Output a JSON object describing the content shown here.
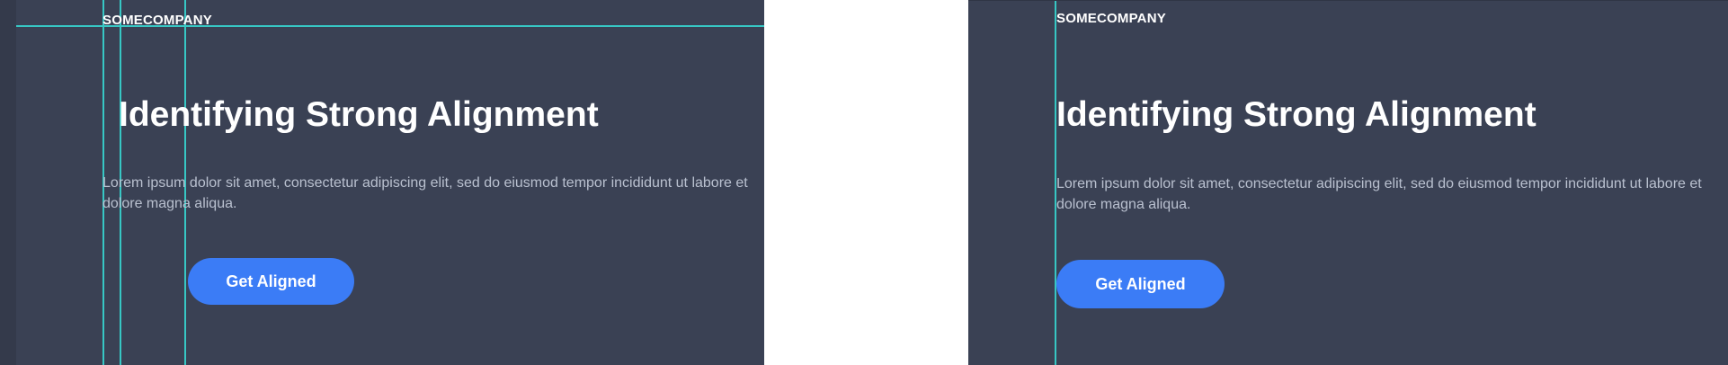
{
  "comparison": {
    "left": {
      "brand": "SOMECOMPANY",
      "headline": "Identifying Strong Alignment",
      "body": "Lorem ipsum dolor sit amet, consectetur adipiscing elit, sed do eiusmod tempor incididunt ut labore et dolore magna aliqua.",
      "cta_label": "Get Aligned"
    },
    "right": {
      "brand": "SOMECOMPANY",
      "headline": "Identifying Strong Alignment",
      "body": "Lorem ipsum dolor sit amet, consectetur adipiscing elit, sed do eiusmod tempor incididunt ut labore et dolore magna aliqua.",
      "cta_label": "Get Aligned"
    }
  },
  "colors": {
    "panel_background": "#3a4154",
    "guide_lines": "#37c7c4",
    "button": "#3b7cf6",
    "headline": "#ffffff",
    "body_text": "#b9c0cf"
  }
}
